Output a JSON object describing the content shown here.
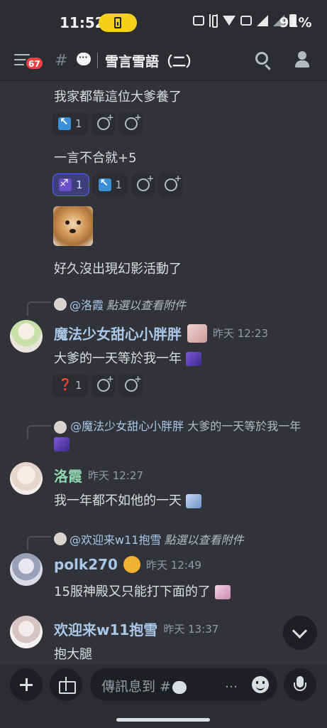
{
  "status_bar": {
    "time": "11:52",
    "battery_pct": "91%"
  },
  "header": {
    "unread_badge": "67",
    "hash": "#",
    "channel_name": "雪言雪語（二）"
  },
  "colors": {
    "background": "#313338",
    "header": "#2b2d31",
    "accent": "#5865f2",
    "badge": "#f23f43",
    "name_blue": "#a9c7e8",
    "name_green": "#8fd6b1"
  },
  "messages": {
    "m1": {
      "text": "我家都靠這位大爹養了",
      "reactions": [
        {
          "icon": "arrow-up-left-emoji",
          "count": "1"
        }
      ]
    },
    "m2": {
      "text": "一言不合就+5",
      "reactions": [
        {
          "icon": "purple-sticker-emoji",
          "count": "1"
        },
        {
          "icon": "arrow-up-left-emoji",
          "count": "1"
        }
      ]
    },
    "m3": {
      "text": "好久沒出現幻影活動了"
    },
    "m4": {
      "reply_name": "@洛霞",
      "reply_text": "點選以查看附件",
      "author": "魔法少女甜心小胖胖",
      "timestamp": "昨天 12:23",
      "text": "大爹的一天等於我一年",
      "reactions": [
        {
          "icon": "red-question-emoji",
          "count": "1"
        }
      ]
    },
    "m5": {
      "reply_name": "@魔法少女甜心小胖胖",
      "reply_text": "大爹的一天等於我一年",
      "author": "洛霞",
      "timestamp": "昨天 12:27",
      "text": "我一年都不如他的一天"
    },
    "m6": {
      "reply_name": "@欢迎来w11抱雪",
      "reply_text": "點選以查看附件",
      "author": "polk270",
      "timestamp": "昨天 12:49",
      "text": "15服神殿又只能打下面的了"
    },
    "m7": {
      "author": "欢迎来w11抱雪",
      "timestamp": "昨天 13:37",
      "text": "抱大腿"
    }
  },
  "composer": {
    "placeholder": "傳訊息到 #",
    "ellipsis": "..."
  }
}
